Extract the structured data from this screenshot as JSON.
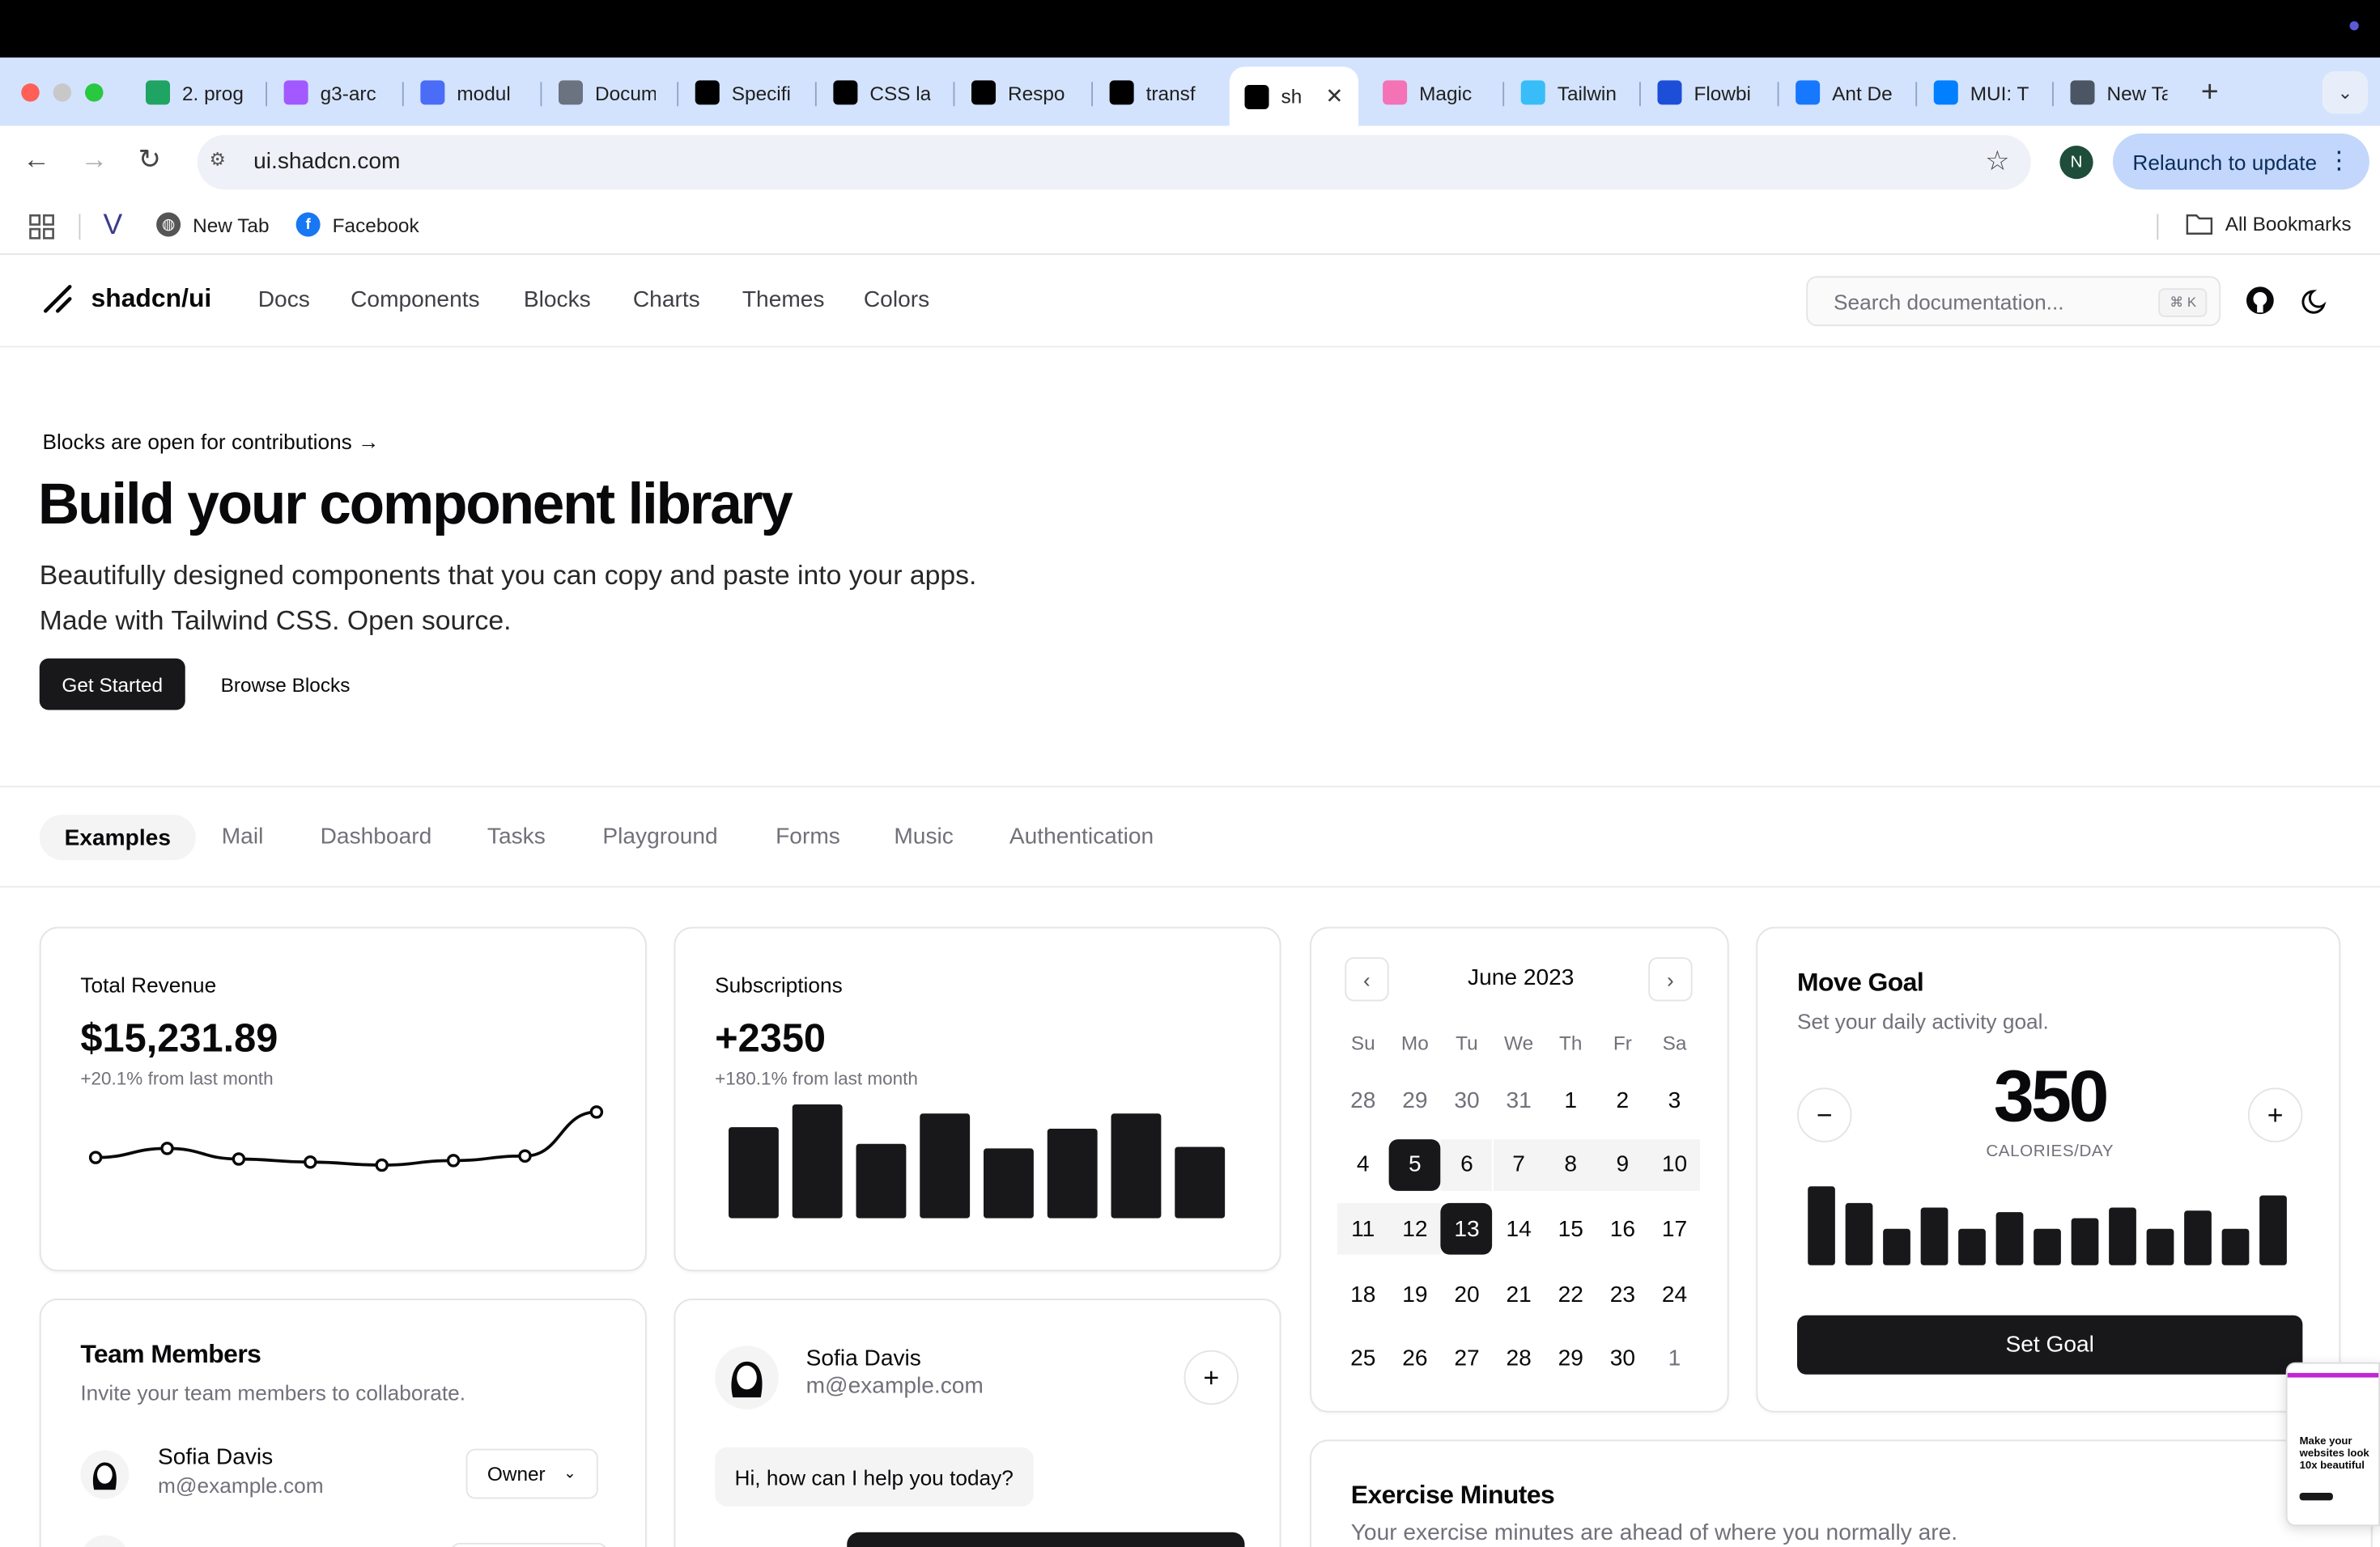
{
  "browser": {
    "tabs": [
      {
        "label": "2. prog",
        "icon": "google-drive-icon",
        "color": "#1fa463"
      },
      {
        "label": "g3-arc",
        "icon": "figma-icon",
        "color": "#a259ff"
      },
      {
        "label": "modul",
        "icon": "docs-icon",
        "color": "#4a6cf7"
      },
      {
        "label": "Docum",
        "icon": "globe-icon",
        "color": "#6b7280"
      },
      {
        "label": "Specifi",
        "icon": "mdn-icon",
        "color": "#000000"
      },
      {
        "label": "CSS la",
        "icon": "mdn-icon",
        "color": "#000000"
      },
      {
        "label": "Respo",
        "icon": "mdn-icon",
        "color": "#000000"
      },
      {
        "label": "transf",
        "icon": "mdn-icon",
        "color": "#000000"
      },
      {
        "label": "sh",
        "icon": "shadcn-icon",
        "color": "#000000",
        "active": true
      },
      {
        "label": "Magic",
        "icon": "magicui-icon",
        "color": "#f472b6"
      },
      {
        "label": "Tailwin",
        "icon": "tailwind-icon",
        "color": "#38bdf8"
      },
      {
        "label": "Flowbi",
        "icon": "flowbite-icon",
        "color": "#1d4ed8"
      },
      {
        "label": "Ant De",
        "icon": "antdesign-icon",
        "color": "#1677ff"
      },
      {
        "label": "MUI: T",
        "icon": "mui-icon",
        "color": "#007fff"
      },
      {
        "label": "New Ta",
        "icon": "chrome-icon",
        "color": "#4b5563"
      }
    ],
    "url": "ui.shadcn.com",
    "profile_initial": "N",
    "relaunch_label": "Relaunch to update",
    "bookmarks": [
      {
        "label": "",
        "icon": "v-logo-icon"
      },
      {
        "label": "New Tab",
        "icon": "globe-icon"
      },
      {
        "label": "Facebook",
        "icon": "facebook-icon"
      }
    ],
    "all_bookmarks_label": "All Bookmarks"
  },
  "site": {
    "logo_text": "shadcn/ui",
    "nav": [
      "Docs",
      "Components",
      "Blocks",
      "Charts",
      "Themes",
      "Colors"
    ],
    "search_placeholder": "Search documentation...",
    "search_kbd": "⌘ K"
  },
  "hero": {
    "announcement": "Blocks are open for contributions",
    "title": "Build your component library",
    "subtitle_line1": "Beautifully designed components that you can copy and paste into your apps.",
    "subtitle_line2": "Made with Tailwind CSS. Open source.",
    "primary_button": "Get Started",
    "secondary_button": "Browse Blocks"
  },
  "examples_tabs": [
    "Examples",
    "Mail",
    "Dashboard",
    "Tasks",
    "Playground",
    "Forms",
    "Music",
    "Authentication"
  ],
  "revenue": {
    "label": "Total Revenue",
    "value": "$15,231.89",
    "note": "+20.1% from last month",
    "chart_data": {
      "type": "line",
      "values": [
        12,
        15,
        11.5,
        10.5,
        9.5,
        11,
        12.5,
        27
      ]
    }
  },
  "subscriptions": {
    "label": "Subscriptions",
    "value": "+2350",
    "note": "+180.1% from last month",
    "chart_data": {
      "type": "bar",
      "values": [
        60,
        75,
        49,
        69,
        46,
        59,
        69,
        47
      ]
    }
  },
  "calendar": {
    "title": "June 2023",
    "weekdays": [
      "Su",
      "Mo",
      "Tu",
      "We",
      "Th",
      "Fr",
      "Sa"
    ],
    "weeks": [
      [
        "28",
        "29",
        "30",
        "31",
        "1",
        "2",
        "3"
      ],
      [
        "4",
        "5",
        "6",
        "7",
        "8",
        "9",
        "10"
      ],
      [
        "11",
        "12",
        "13",
        "14",
        "15",
        "16",
        "17"
      ],
      [
        "18",
        "19",
        "20",
        "21",
        "22",
        "23",
        "24"
      ],
      [
        "25",
        "26",
        "27",
        "28",
        "29",
        "30",
        "1"
      ]
    ],
    "selected_start": "5",
    "selected_end": "13"
  },
  "move_goal": {
    "title": "Move Goal",
    "description": "Set your daily activity goal.",
    "value": "350",
    "unit": "CALORIES/DAY",
    "button": "Set Goal",
    "chart_data": {
      "type": "bar",
      "values": [
        52,
        41,
        24,
        38,
        24,
        35,
        24,
        31,
        38,
        24,
        36,
        24,
        46
      ]
    }
  },
  "team": {
    "title": "Team Members",
    "description": "Invite your team members to collaborate.",
    "members": [
      {
        "name": "Sofia Davis",
        "email": "m@example.com",
        "role": "Owner"
      }
    ]
  },
  "chat": {
    "name": "Sofia Davis",
    "email": "m@example.com",
    "message": "Hi, how can I help you today?"
  },
  "exercise": {
    "title": "Exercise Minutes",
    "description": "Your exercise minutes are ahead of where you normally are."
  },
  "thumbnail": {
    "text": "Make your websites look 10x beautiful"
  }
}
